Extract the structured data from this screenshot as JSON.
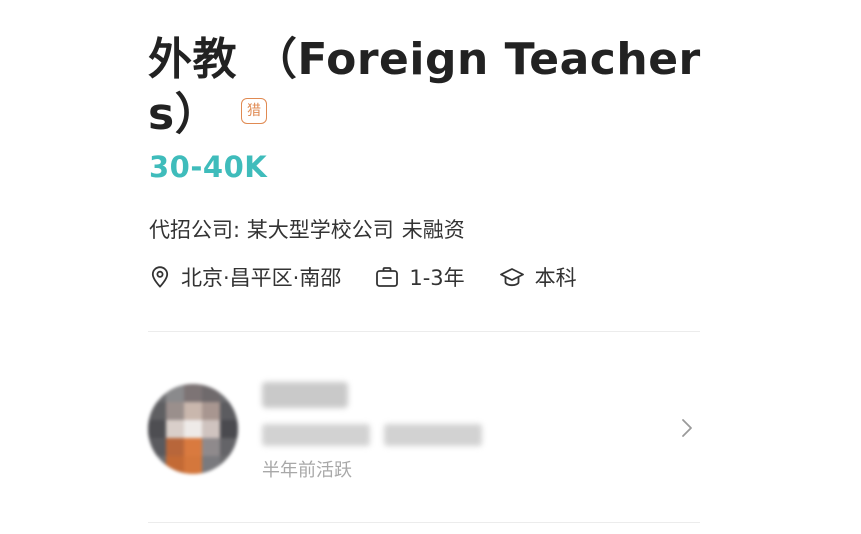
{
  "job": {
    "title": "外教 （Foreign Teachers）",
    "hunter_badge": "猎",
    "salary": "30-40K"
  },
  "company": {
    "label": "代招公司:",
    "name": "某大型学校公司",
    "funding": "未融资"
  },
  "meta": {
    "location": "北京·昌平区·南邵",
    "experience": "1-3年",
    "education": "本科",
    "icons": [
      "location-pin-icon",
      "briefcase-icon",
      "graduation-cap-icon"
    ]
  },
  "recruiter": {
    "active_status": "半年前活跃",
    "chevron_icon": "chevron-right-icon"
  },
  "colors": {
    "salary": "#3fbcbb",
    "badge": "#e08a52",
    "text": "#222222",
    "muted": "#a8a8a8"
  }
}
